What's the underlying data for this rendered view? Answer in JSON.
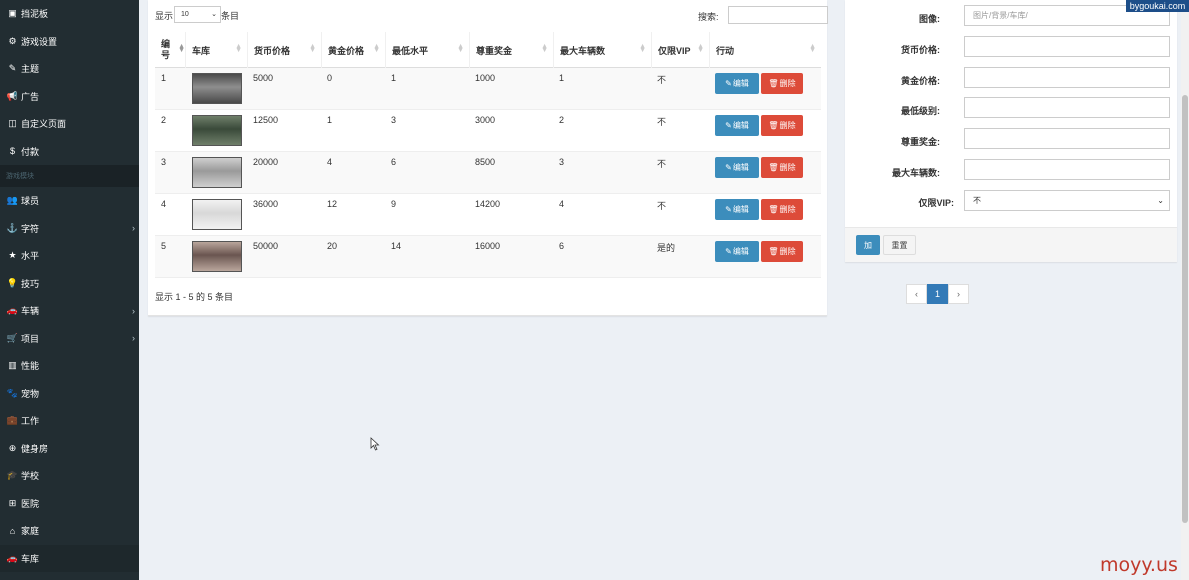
{
  "sidebar": {
    "items": [
      {
        "icon": "dashboard-icon",
        "glyph": "▣",
        "label": "挡泥板"
      },
      {
        "icon": "gears-icon",
        "glyph": "⚙",
        "label": "游戏设置"
      },
      {
        "icon": "brush-icon",
        "glyph": "✎",
        "label": "主题"
      },
      {
        "icon": "bullhorn-icon",
        "glyph": "📢",
        "label": "广告"
      },
      {
        "icon": "page-icon",
        "glyph": "◫",
        "label": "自定义页面"
      },
      {
        "icon": "dollar-icon",
        "glyph": "$",
        "label": "付款"
      }
    ],
    "section_header": "游戏模块",
    "game_items": [
      {
        "icon": "users-icon",
        "glyph": "👥",
        "label": "球员"
      },
      {
        "icon": "anchor-icon",
        "glyph": "⚓",
        "label": "字符",
        "has_chevron": true
      },
      {
        "icon": "star-icon",
        "glyph": "★",
        "label": "水平"
      },
      {
        "icon": "lightbulb-icon",
        "glyph": "💡",
        "label": "技巧"
      },
      {
        "icon": "car-icon",
        "glyph": "🚗",
        "label": "车辆",
        "has_chevron": true
      },
      {
        "icon": "cart-icon",
        "glyph": "🛒",
        "label": "项目",
        "has_chevron": true
      },
      {
        "icon": "book-icon",
        "glyph": "▥",
        "label": "性能"
      },
      {
        "icon": "paw-icon",
        "glyph": "🐾",
        "label": "宠物"
      },
      {
        "icon": "briefcase-icon",
        "glyph": "💼",
        "label": "工作"
      },
      {
        "icon": "gym-icon",
        "glyph": "⊕",
        "label": "健身房"
      },
      {
        "icon": "graduation-icon",
        "glyph": "🎓",
        "label": "学校"
      },
      {
        "icon": "hospital-icon",
        "glyph": "⊞",
        "label": "医院"
      },
      {
        "icon": "home-icon",
        "glyph": "⌂",
        "label": "家庭"
      },
      {
        "icon": "garage-car-icon",
        "glyph": "🚗",
        "label": "车库"
      }
    ]
  },
  "table": {
    "length_prefix": "显示",
    "length_value": "10",
    "length_suffix": "条目",
    "search_label": "搜索:",
    "headers": [
      "编号",
      "车库",
      "货币价格",
      "黄金价格",
      "最低水平",
      "尊重奖金",
      "最大车辆数",
      "仅限VIP",
      "行动"
    ],
    "rows": [
      {
        "id": "1",
        "money": "5000",
        "gold": "0",
        "min_level": "1",
        "respect": "1000",
        "max_vehicles": "1",
        "vip": "不"
      },
      {
        "id": "2",
        "money": "12500",
        "gold": "1",
        "min_level": "3",
        "respect": "3000",
        "max_vehicles": "2",
        "vip": "不"
      },
      {
        "id": "3",
        "money": "20000",
        "gold": "4",
        "min_level": "6",
        "respect": "8500",
        "max_vehicles": "3",
        "vip": "不"
      },
      {
        "id": "4",
        "money": "36000",
        "gold": "12",
        "min_level": "9",
        "respect": "14200",
        "max_vehicles": "4",
        "vip": "不"
      },
      {
        "id": "5",
        "money": "50000",
        "gold": "20",
        "min_level": "14",
        "respect": "16000",
        "max_vehicles": "6",
        "vip": "是的"
      }
    ],
    "edit_label": "编辑",
    "delete_label": "删除",
    "info": "显示 1 - 5 的 5 条目",
    "pagination": {
      "prev": "‹",
      "current": "1",
      "next": "›"
    }
  },
  "form": {
    "fields": [
      {
        "label": "图像:",
        "placeholder": "图片/背景/车库/"
      },
      {
        "label": "货币价格:",
        "placeholder": ""
      },
      {
        "label": "黄金价格:",
        "placeholder": ""
      },
      {
        "label": "最低级别:",
        "placeholder": ""
      },
      {
        "label": "尊重奖金:",
        "placeholder": ""
      },
      {
        "label": "最大车辆数:",
        "placeholder": ""
      }
    ],
    "vip_label": "仅限VIP:",
    "vip_value": "不",
    "add_label": "加",
    "reset_label": "重置"
  },
  "watermarks": {
    "top": "bygoukai.com",
    "bottom": "moyy.us"
  }
}
